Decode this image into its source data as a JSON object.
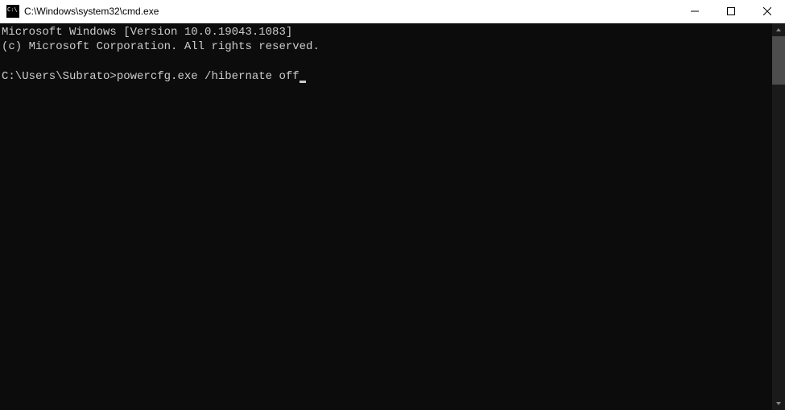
{
  "titlebar": {
    "title": "C:\\Windows\\system32\\cmd.exe"
  },
  "terminal": {
    "line1": "Microsoft Windows [Version 10.0.19043.1083]",
    "line2": "(c) Microsoft Corporation. All rights reserved.",
    "prompt": "C:\\Users\\Subrato>",
    "command": "powercfg.exe /hibernate off"
  }
}
